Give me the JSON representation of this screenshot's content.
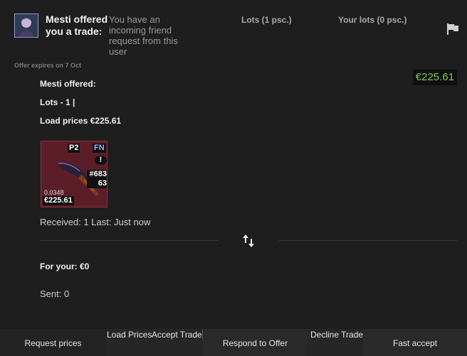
{
  "header": {
    "offer_title": "Mesti offered you a trade:",
    "friend_request_note": "You have an incoming friend request from this user",
    "tab_lots": "Lots (1 psc.)",
    "tab_your_lots": "Your lots (0 psc.)",
    "offer_expires": "Offer expires on 7 Oct"
  },
  "summary": {
    "total_value": "€225.61",
    "offered_by": "Mesti offered:",
    "lots_count": "Lots - 1 |",
    "load_prices": "Load prices €225.61"
  },
  "item": {
    "phase": "P2",
    "wear": "FN",
    "warning_glyph": "!",
    "pattern_top": "#683",
    "pattern_bottom": "63",
    "float": "0.0348",
    "price": "€225.61",
    "card_color": "#5b1e29"
  },
  "received_text": "Received: 1 Last: Just now",
  "for_your_text": "For your: €0",
  "sent_text": "Sent: 0",
  "buttons": {
    "request_prices": "Request prices",
    "load_prices": "Load Prices",
    "accept_trade": "Accept Trade",
    "respond_to_offer": "Respond to Offer",
    "decline_trade": "Decline Trade",
    "fast_accept": "Fast accept"
  },
  "icons": {
    "flag": "flag-icon",
    "swap": "swap-arrows-icon",
    "warning": "warning-icon"
  },
  "colors": {
    "price_green": "#7ec95a",
    "background": "#1e1e1e"
  }
}
